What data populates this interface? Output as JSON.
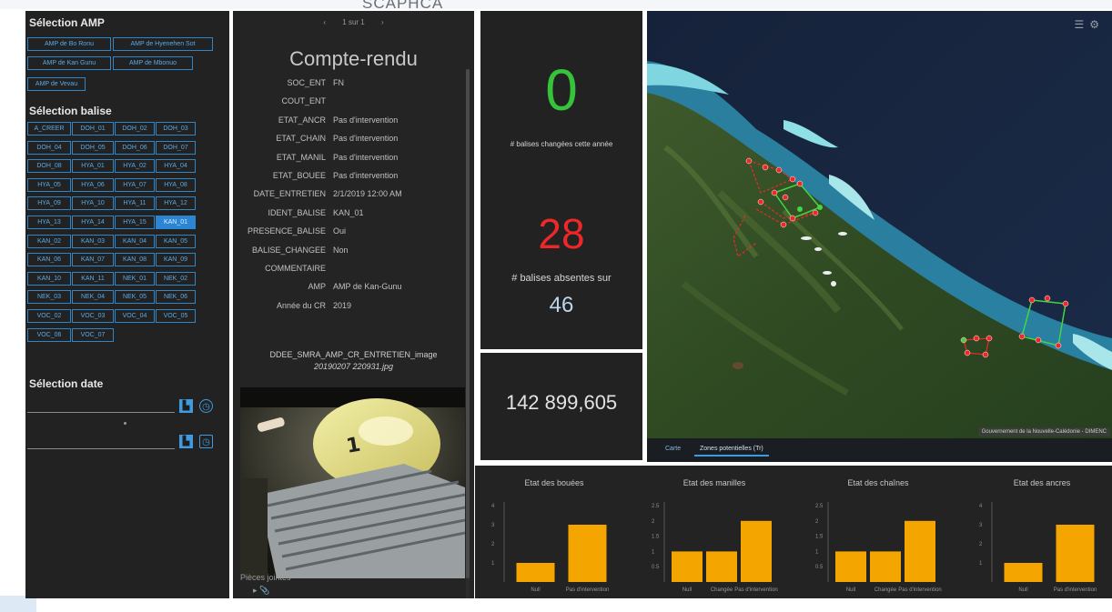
{
  "window": {
    "overlay_title": "SCAPHCA"
  },
  "colors": {
    "accent": "#2e86c9",
    "bar": "#f5a500",
    "zero": "#36c23a",
    "missing": "#ee2828",
    "total": "#bcd6ec"
  },
  "left": {
    "amp_title": "Sélection AMP",
    "amp_buttons": [
      "AMP de Bo Ronu",
      "AMP de Hyenehen Sot",
      "AMP de Kan Gunu",
      "AMP de Mbonuo",
      "AMP de Vevau"
    ],
    "balise_title": "Sélection balise",
    "balise_buttons": [
      "A_CREER",
      "DOH_01",
      "DOH_02",
      "DOH_03",
      "DOH_04",
      "DOH_05",
      "DOH_06",
      "DOH_07",
      "DOH_08",
      "HYA_01",
      "HYA_02",
      "HYA_04",
      "HYA_05",
      "HYA_06",
      "HYA_07",
      "HYA_08",
      "HYA_09",
      "HYA_10",
      "HYA_11",
      "HYA_12",
      "HYA_13",
      "HYA_14",
      "HYA_15",
      "KAN_01",
      "KAN_02",
      "KAN_03",
      "KAN_04",
      "KAN_05",
      "KAN_06",
      "KAN_07",
      "KAN_08",
      "KAN_09",
      "KAN_10",
      "KAN_11",
      "NEK_01",
      "NEK_02",
      "NEK_03",
      "NEK_04",
      "NEK_05",
      "NEK_06",
      "VOC_02",
      "VOC_03",
      "VOC_04",
      "VOC_05",
      "VOC_06",
      "VOC_07"
    ],
    "selected_balise": "KAN_01",
    "date_title": "Sélection date"
  },
  "detail": {
    "pager_prev": "‹",
    "pager_text": "1 sur 1",
    "pager_next": "›",
    "title": "Compte-rendu",
    "fields": [
      {
        "key": "SOC_ENT",
        "value": "FN"
      },
      {
        "key": "COUT_ENT",
        "value": ""
      },
      {
        "key": "ETAT_ANCR",
        "value": "Pas d'intervention"
      },
      {
        "key": "ETAT_CHAIN",
        "value": "Pas d'intervention"
      },
      {
        "key": "ETAT_MANIL",
        "value": "Pas d'intervention"
      },
      {
        "key": "ETAT_BOUEE",
        "value": "Pas d'intervention"
      },
      {
        "key": "DATE_ENTRETIEN",
        "value": "2/1/2019 12:00 AM"
      },
      {
        "key": "IDENT_BALISE",
        "value": "KAN_01"
      },
      {
        "key": "PRESENCE_BALISE",
        "value": "Oui"
      },
      {
        "key": "BALISE_CHANGEE",
        "value": "Non"
      },
      {
        "key": "COMMENTAIRE",
        "value": ""
      },
      {
        "key": "AMP",
        "value": "AMP de Kan-Gunu"
      },
      {
        "key": "Année du CR",
        "value": "2019"
      }
    ],
    "filename_line1": "DDEE_SMRA_AMP_CR_ENTRETIEN_image",
    "filename_line2": "20190207 220931.jpg",
    "attachments_label": "Pièces jointes",
    "attachment_icon": "paperclip-icon"
  },
  "kpi": {
    "changed_count": "0",
    "changed_caption": "# balises changées cette année",
    "missing_count": "28",
    "missing_caption": "# balises absentes sur",
    "total_count": "46",
    "area_value": "142 899,605"
  },
  "map": {
    "attribution": "Gouvernement de la Nouvelle-Calédonie - DIMENC",
    "tabs": [
      "Carte",
      "Zones potentielles (Tr)"
    ],
    "active_tab": 1,
    "tools": [
      "list-icon",
      "layers-icon"
    ]
  },
  "chart_data": [
    {
      "type": "bar",
      "title": "Etat des bouées",
      "categories": [
        "Null",
        "Pas d'intervention"
      ],
      "values": [
        1,
        3
      ],
      "ylim": [
        0,
        4
      ],
      "ticks": [
        1,
        2,
        3,
        4
      ]
    },
    {
      "type": "bar",
      "title": "Etat des manilles",
      "categories": [
        "Null",
        "Changée",
        "Pas d'intervention"
      ],
      "values": [
        1,
        1,
        2
      ],
      "ylim": [
        0,
        2.5
      ],
      "ticks": [
        0.5,
        1,
        1.5,
        2,
        2.5
      ]
    },
    {
      "type": "bar",
      "title": "Etat des chaînes",
      "categories": [
        "Null",
        "Changée",
        "Pas d'intervention"
      ],
      "values": [
        1,
        1,
        2
      ],
      "ylim": [
        0,
        2.5
      ],
      "ticks": [
        0.5,
        1,
        1.5,
        2,
        2.5
      ]
    },
    {
      "type": "bar",
      "title": "Etat des ancres",
      "categories": [
        "Null",
        "Pas d'intervention"
      ],
      "values": [
        1,
        3
      ],
      "ylim": [
        0,
        4
      ],
      "ticks": [
        1,
        2,
        3,
        4
      ]
    }
  ]
}
